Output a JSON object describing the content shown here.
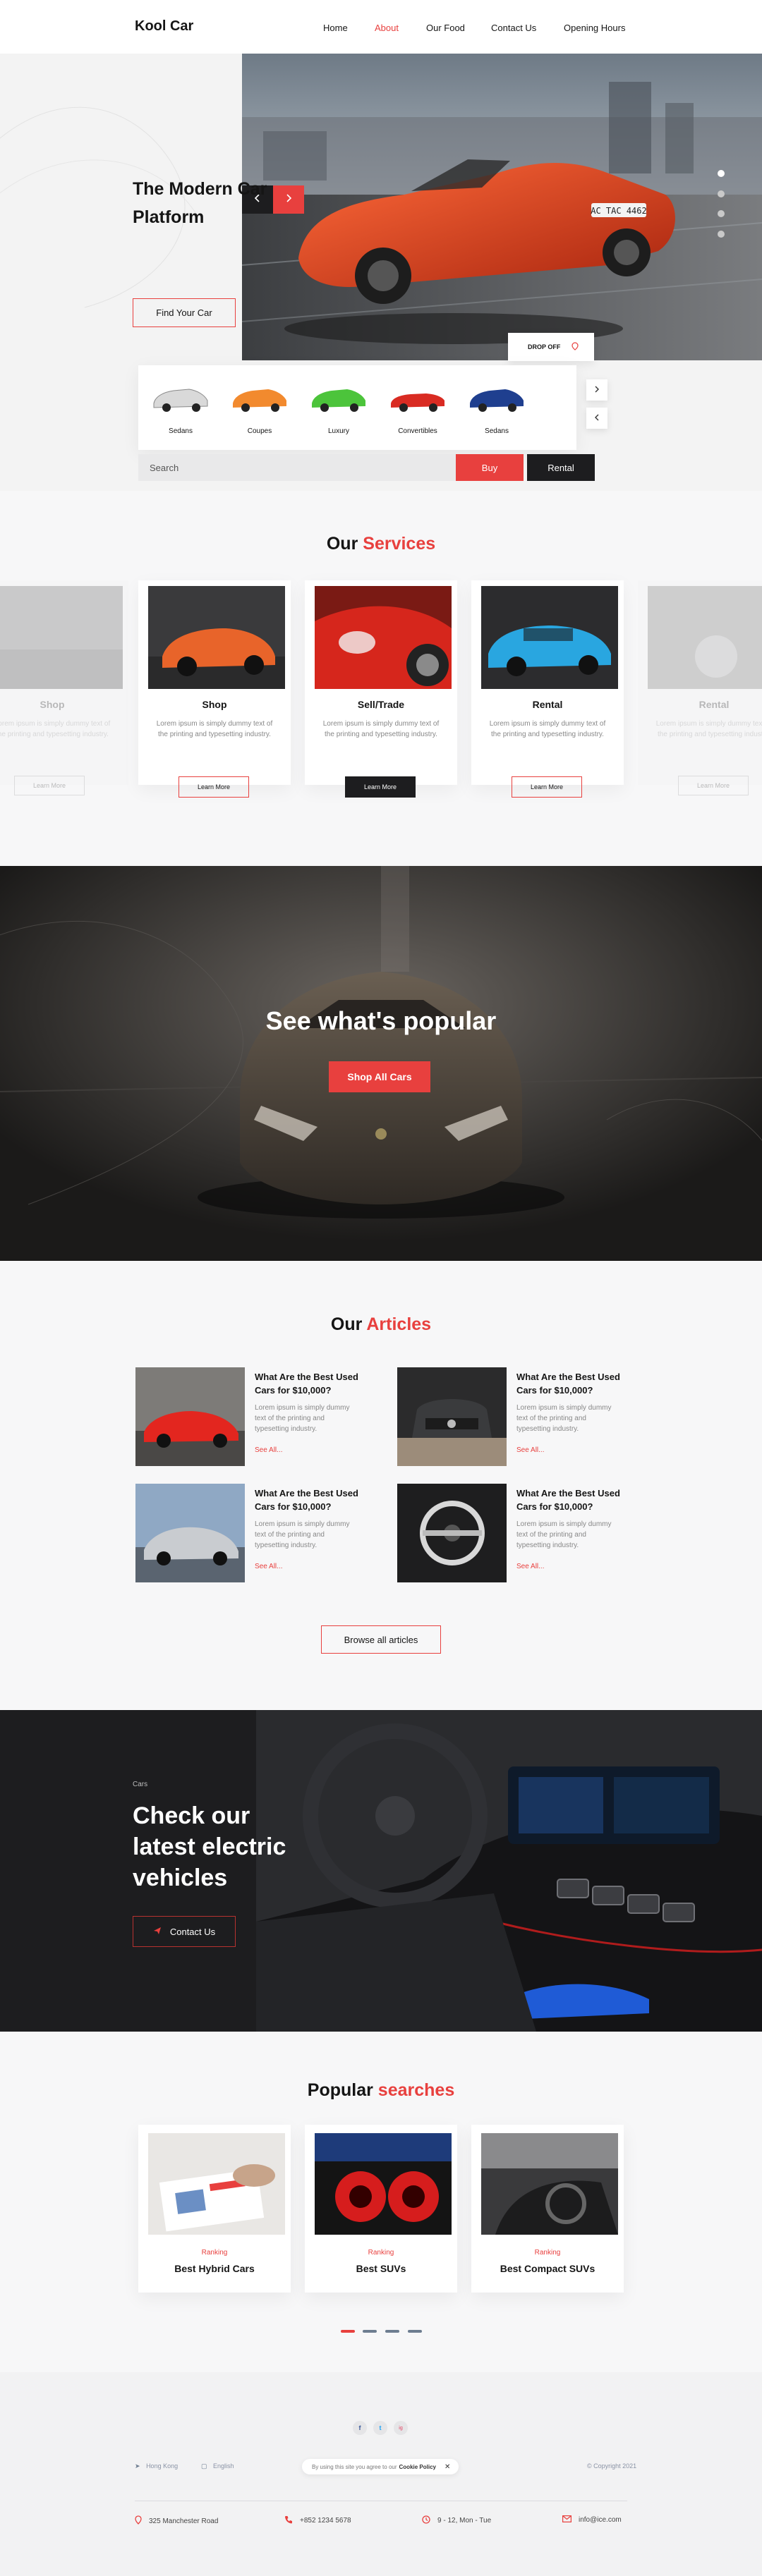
{
  "header": {
    "logo": "Kool Car",
    "nav": [
      "Home",
      "About",
      "Our Food",
      "Contact Us",
      "Opening Hours"
    ],
    "active_index": 1
  },
  "hero": {
    "title": "The Modern Car Platform",
    "cta": "Find Your Car",
    "plate": "AC TAC 4462",
    "dropoff": "DROP OFF",
    "categories": [
      "Sedans",
      "Coupes",
      "Luxury",
      "Convertibles",
      "Sedans"
    ],
    "search_placeholder": "Search",
    "buy": "Buy",
    "rental": "Rental"
  },
  "services": {
    "title_a": "Our",
    "title_b": "Services",
    "cards": [
      {
        "name": "Shop",
        "desc": "Lorem ipsum is simply dummy text of the printing and typesetting industry.",
        "button": "Learn More"
      },
      {
        "name": "Shop",
        "desc": "Lorem ipsum is simply dummy text of the printing and typesetting industry.",
        "button": "Learn More"
      },
      {
        "name": "Sell/Trade",
        "desc": "Lorem ipsum is simply dummy text of the printing and typesetting industry.",
        "button": "Learn More"
      },
      {
        "name": "Rental",
        "desc": "Lorem ipsum is simply dummy text of the printing and typesetting industry.",
        "button": "Learn More"
      },
      {
        "name": "Rental",
        "desc": "Lorem ipsum is simply dummy text of the printing and typesetting industry.",
        "button": "Learn More"
      }
    ]
  },
  "banner": {
    "title": "See what's popular",
    "button": "Shop All Cars"
  },
  "articles": {
    "title_a": "Our",
    "title_b": "Articles",
    "items": [
      {
        "title": "What Are the Best Used Cars for $10,000?",
        "desc": "Lorem ipsum is simply dummy text of the printing and typesetting industry.",
        "link": "See All..."
      },
      {
        "title": "What Are the Best Used Cars for $10,000?",
        "desc": "Lorem ipsum is simply dummy text of the printing and typesetting industry.",
        "link": "See All..."
      },
      {
        "title": "What Are the Best Used Cars for $10,000?",
        "desc": "Lorem ipsum is simply dummy text of the printing and typesetting industry.",
        "link": "See All..."
      },
      {
        "title": "What Are the Best Used Cars for $10,000?",
        "desc": "Lorem ipsum is simply dummy text of the printing and typesetting industry.",
        "link": "See All..."
      }
    ],
    "browse": "Browse all articles"
  },
  "cta": {
    "small": "Cars",
    "title": "Check our latest electric vehicles",
    "button": "Contact Us"
  },
  "popular": {
    "title_a": "Popular",
    "title_b": "searches",
    "cards": [
      {
        "rank": "Ranking",
        "name": "Best Hybrid Cars"
      },
      {
        "rank": "Ranking",
        "name": "Best SUVs"
      },
      {
        "rank": "Ranking",
        "name": "Best Compact SUVs"
      }
    ]
  },
  "footer": {
    "social": [
      "f",
      "t",
      "ig"
    ],
    "lang_region": "Hong Kong",
    "lang": "English",
    "cookie_text": "By using this site you agree to our",
    "cookie_link": "Cookie Policy",
    "copyright": "© Copyright 2021",
    "address": "325 Manchester Road",
    "phone": "+852 1234 5678",
    "hours": "9 - 12, Mon - Tue",
    "email": "info@ice.com"
  },
  "colors": {
    "accent": "#e8403e",
    "dark": "#1d1d1f",
    "bg": "#f7f7f8"
  }
}
